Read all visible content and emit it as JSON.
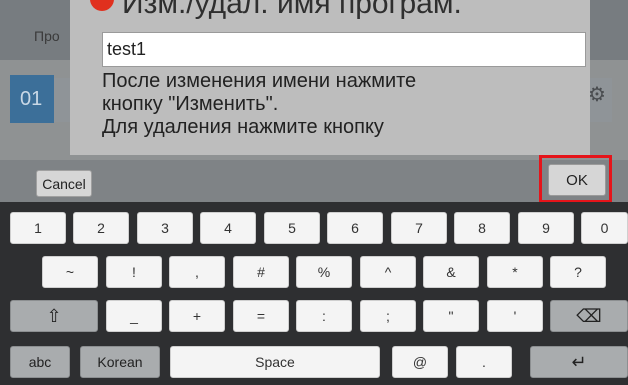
{
  "background": {
    "header_text": "Про",
    "row_number": "01",
    "gear_icon": "gear-icon"
  },
  "dialog": {
    "title": "Изм./удал. имя програм.",
    "input_value": "test1",
    "message_lines": [
      "После изменения имени нажмите",
      "кнопку \"Изменить\".",
      "Для удаления нажмите кнопку"
    ]
  },
  "keyboard_bar": {
    "cancel_label": "Cancel",
    "ok_label": "OK",
    "highlight_color": "#e5141a"
  },
  "keyboard": {
    "row1": [
      "1",
      "2",
      "3",
      "4",
      "5",
      "6",
      "7",
      "8",
      "9",
      "0"
    ],
    "row2": [
      "~",
      "!",
      ",",
      "#",
      "%",
      "^",
      "&",
      "*",
      "?"
    ],
    "row3": [
      "_",
      "+",
      "=",
      ":",
      ";",
      "\"",
      "'"
    ],
    "shift_icon": "shift-icon",
    "backspace_icon": "backspace-icon",
    "enter_icon": "enter-icon",
    "row4": {
      "abc": "abc",
      "korean": "Korean",
      "space": "Space",
      "at": "@",
      "dot": "."
    }
  }
}
